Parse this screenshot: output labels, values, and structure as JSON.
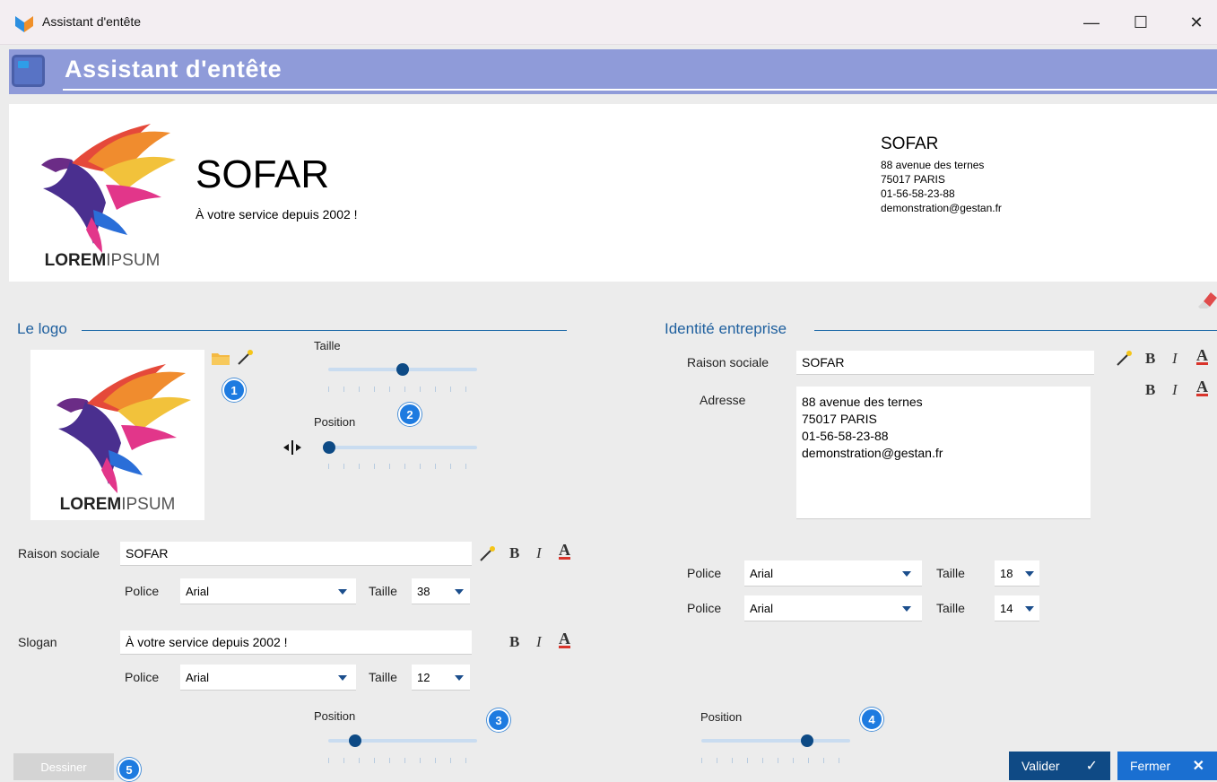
{
  "window": {
    "title": "Assistant d'entête",
    "minimize": "—",
    "maximize": "☐",
    "close": "✕"
  },
  "header": {
    "title": "Assistant d'entête"
  },
  "preview": {
    "company_name": "SOFAR",
    "slogan": "À votre service depuis 2002 !",
    "logo_text_bold": "LOREM",
    "logo_text_light": "IPSUM",
    "identity": {
      "name": "SOFAR",
      "lines": [
        "88 avenue des ternes",
        "75017 PARIS",
        "01-56-58-23-88",
        "demonstration@gestan.fr"
      ]
    }
  },
  "logo_section": {
    "title": "Le logo",
    "logo_text_bold": "LOREM",
    "logo_text_light": "IPSUM",
    "size_label": "Taille",
    "size_value": 0.5,
    "position_label": "Position",
    "position_value": 0.0,
    "badge_1": "1",
    "badge_2": "2"
  },
  "company_fields": {
    "raison_label": "Raison sociale",
    "raison_value": "SOFAR",
    "police_label": "Police",
    "police_value": "Arial",
    "taille_label": "Taille",
    "taille_value": "38",
    "slogan_label": "Slogan",
    "slogan_value": "À votre service depuis 2002 !",
    "slogan_police_label": "Police",
    "slogan_police_value": "Arial",
    "slogan_taille_label": "Taille",
    "slogan_taille_value": "12",
    "position_label": "Position",
    "position_value": 0.15,
    "badge_3": "3"
  },
  "identity_section": {
    "title": "Identité entreprise",
    "raison_label": "Raison sociale",
    "raison_value": "SOFAR",
    "adresse_label": "Adresse",
    "adresse_lines": [
      "88 avenue des ternes",
      "75017 PARIS",
      "01-56-58-23-88",
      "demonstration@gestan.fr"
    ],
    "police1_label": "Police",
    "police1_value": "Arial",
    "taille1_label": "Taille",
    "taille1_value": "18",
    "police2_label": "Police",
    "police2_value": "Arial",
    "taille2_label": "Taille",
    "taille2_value": "14",
    "position_label": "Position",
    "position_value": 0.73,
    "badge_4": "4"
  },
  "format": {
    "bold": "B",
    "italic": "I",
    "color": "A"
  },
  "buttons": {
    "dessiner": "Dessiner",
    "badge_5": "5",
    "valider": "Valider",
    "valider_icon": "✓",
    "fermer": "Fermer",
    "fermer_icon": "✕"
  },
  "colors": {
    "accent": "#0f4a85",
    "header": "#8f9bd9",
    "badge": "#1e7be0"
  }
}
